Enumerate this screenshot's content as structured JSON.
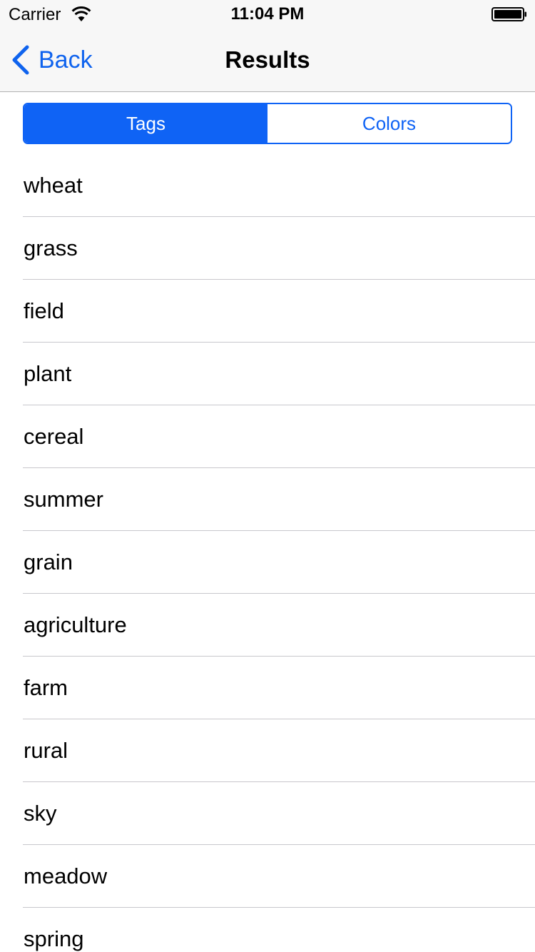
{
  "status_bar": {
    "carrier": "Carrier",
    "time": "11:04 PM"
  },
  "nav": {
    "back_label": "Back",
    "title": "Results"
  },
  "segmented": {
    "tags_label": "Tags",
    "colors_label": "Colors",
    "selected": "Tags"
  },
  "tags": [
    "wheat",
    "grass",
    "field",
    "plant",
    "cereal",
    "summer",
    "grain",
    "agriculture",
    "farm",
    "rural",
    "sky",
    "meadow",
    "spring"
  ],
  "colors": {
    "accent": "#0f63f5",
    "bar_background": "#f7f7f7",
    "separator": "#c8c7cc"
  },
  "icons": {
    "back": "chevron-left-icon",
    "wifi": "wifi-icon",
    "battery": "battery-icon"
  }
}
